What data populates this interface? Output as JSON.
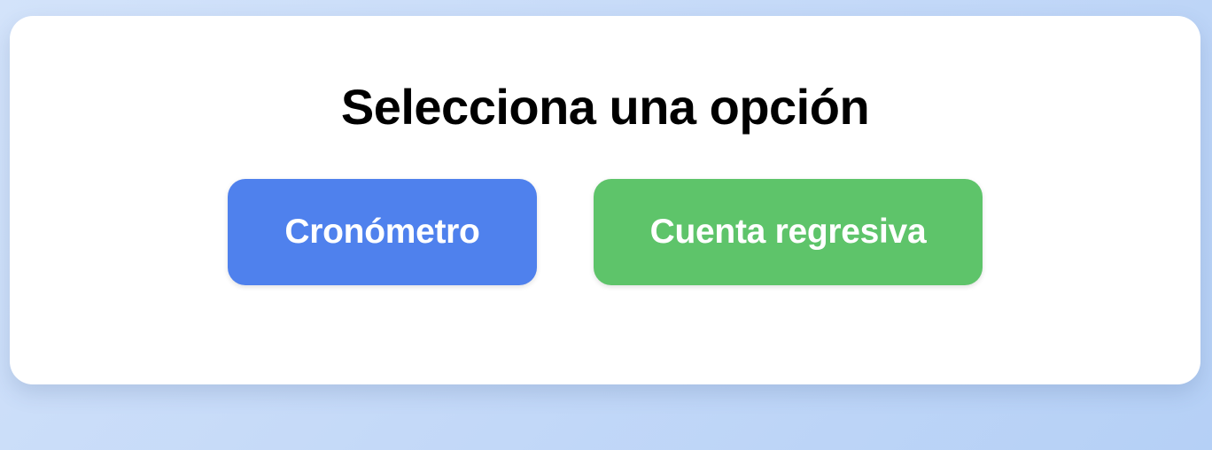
{
  "page": {
    "title": "Selecciona una opción"
  },
  "buttons": {
    "stopwatch_label": "Cronómetro",
    "countdown_label": "Cuenta regresiva"
  },
  "colors": {
    "stopwatch_button": "#4f81ed",
    "countdown_button": "#5ec46a",
    "card_background": "#ffffff"
  }
}
